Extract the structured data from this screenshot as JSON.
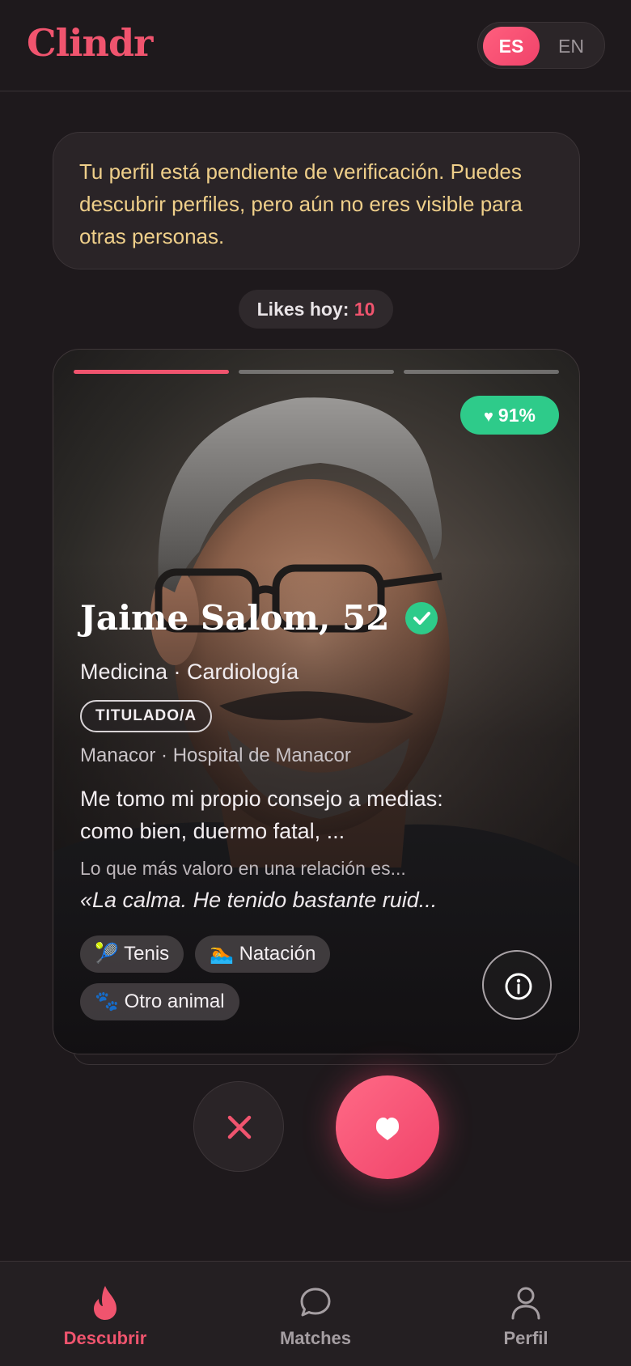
{
  "app": {
    "title": "Clindr"
  },
  "language": {
    "options": [
      "ES",
      "EN"
    ],
    "selected": "ES"
  },
  "notice": {
    "text": "Tu perfil está pendiente de verificación. Puedes descubrir perfiles, pero aún no eres visible para otras personas."
  },
  "likes": {
    "label": "Likes hoy:",
    "count": "10"
  },
  "card": {
    "photo_count": 3,
    "current_photo": 1,
    "match": "91%",
    "name_age": "Jaime Salom, 52",
    "verified": true,
    "specialty": "Medicina · Cardiología",
    "degree": "TITULADO/A",
    "location": "Manacor · Hospital de Manacor",
    "bio": "Me tomo mi propio consejo a medias: como bien, duermo fatal, ...",
    "prompt_question": "Lo que más valoro en una relación es...",
    "prompt_answer": "«La calma. He tenido bastante ruid...",
    "tags": [
      {
        "icon": "tennis-icon",
        "emoji": "🎾",
        "label": "Tenis"
      },
      {
        "icon": "swimming-icon",
        "emoji": "🏊",
        "label": "Natación"
      },
      {
        "icon": "paw-icon",
        "emoji": "🐾",
        "label": "Otro animal"
      }
    ]
  },
  "nav": {
    "items": [
      {
        "label": "Descubrir",
        "icon": "flame-icon",
        "active": true
      },
      {
        "label": "Matches",
        "icon": "chat-bubble-icon",
        "active": false
      },
      {
        "label": "Perfil",
        "icon": "user-icon",
        "active": false
      }
    ]
  },
  "colors": {
    "accent": "#f0546e",
    "match": "#2ecb8a",
    "notice_text": "#efcf8a",
    "background": "#1e191c"
  }
}
